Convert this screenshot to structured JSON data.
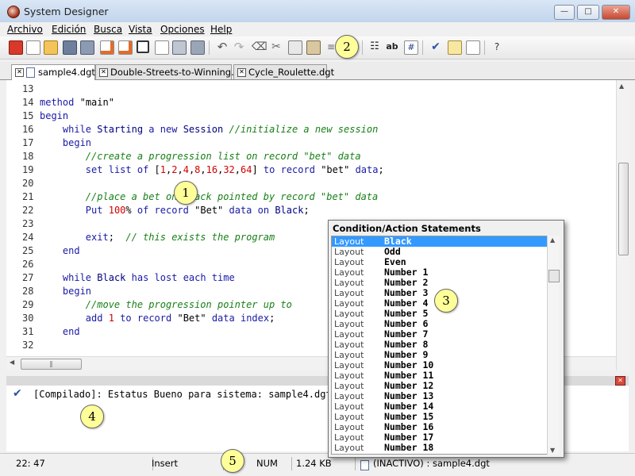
{
  "window": {
    "title": "System Designer"
  },
  "menu": [
    "Archivo",
    "Edición",
    "Busca",
    "Vista",
    "Opciones",
    "Help"
  ],
  "toolbar": {
    "help_label": "?"
  },
  "tabs": [
    "sample4.dgt",
    "Double-Streets-to-Winning.dgt",
    "Cycle_Roulette.dgt"
  ],
  "code_lines": [
    {
      "n": "13",
      "t": ""
    },
    {
      "n": "14",
      "t": "method \"main\""
    },
    {
      "n": "15",
      "t": "begin"
    },
    {
      "n": "16",
      "t": "    while Starting a new Session //initialize a new session"
    },
    {
      "n": "17",
      "t": "    begin"
    },
    {
      "n": "18",
      "t": "        //create a progression list on record \"bet\" data"
    },
    {
      "n": "19",
      "t": "        set list of [1,2,4,8,16,32,64] to record \"bet\" data;"
    },
    {
      "n": "20",
      "t": ""
    },
    {
      "n": "21",
      "t": "        //place a bet on Black pointed by record \"bet\" data"
    },
    {
      "n": "22",
      "t": "        Put 100% of record \"Bet\" data on Black;"
    },
    {
      "n": "23",
      "t": ""
    },
    {
      "n": "24",
      "t": "        exit;  // this exists the program"
    },
    {
      "n": "25",
      "t": "    end"
    },
    {
      "n": "26",
      "t": ""
    },
    {
      "n": "27",
      "t": "    while Black has lost each time"
    },
    {
      "n": "28",
      "t": "    begin"
    },
    {
      "n": "29",
      "t": "        //move the progression pointer up to"
    },
    {
      "n": "30",
      "t": "        add 1 to record \"Bet\" data index;"
    },
    {
      "n": "31",
      "t": "    end"
    },
    {
      "n": "32",
      "t": ""
    }
  ],
  "output": {
    "message": "[Compilado]: Estatus Bueno para sistema: sample4.dgt"
  },
  "status": {
    "position": "22: 47",
    "mode": "Insert",
    "num": "NUM",
    "size": "1.24 KB",
    "file": "(INACTIVO) : sample4.dgt"
  },
  "popup": {
    "title": "Condition/Action Statements",
    "items": [
      {
        "cat": "Layout",
        "name": "Black"
      },
      {
        "cat": "Layout",
        "name": "Odd"
      },
      {
        "cat": "Layout",
        "name": "Even"
      },
      {
        "cat": "Layout",
        "name": "Number 1"
      },
      {
        "cat": "Layout",
        "name": "Number 2"
      },
      {
        "cat": "Layout",
        "name": "Number 3"
      },
      {
        "cat": "Layout",
        "name": "Number 4"
      },
      {
        "cat": "Layout",
        "name": "Number 5"
      },
      {
        "cat": "Layout",
        "name": "Number 6"
      },
      {
        "cat": "Layout",
        "name": "Number 7"
      },
      {
        "cat": "Layout",
        "name": "Number 8"
      },
      {
        "cat": "Layout",
        "name": "Number 9"
      },
      {
        "cat": "Layout",
        "name": "Number 10"
      },
      {
        "cat": "Layout",
        "name": "Number 11"
      },
      {
        "cat": "Layout",
        "name": "Number 12"
      },
      {
        "cat": "Layout",
        "name": "Number 13"
      },
      {
        "cat": "Layout",
        "name": "Number 14"
      },
      {
        "cat": "Layout",
        "name": "Number 15"
      },
      {
        "cat": "Layout",
        "name": "Number 16"
      },
      {
        "cat": "Layout",
        "name": "Number 17"
      },
      {
        "cat": "Layout",
        "name": "Number 18"
      }
    ],
    "selected_index": 0
  },
  "callouts": [
    "1",
    "2",
    "3",
    "4",
    "5"
  ],
  "colors": {
    "keyword": "#1a1aa6",
    "comment": "#188018",
    "number": "#d00000",
    "selection": "#3399ff",
    "callout": "#ffff99"
  }
}
